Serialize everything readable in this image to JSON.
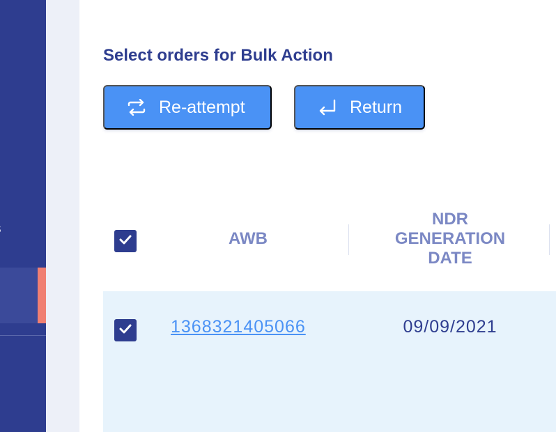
{
  "sidebar": {
    "partial_label": "s"
  },
  "bulk_action": {
    "title": "Select orders for Bulk Action",
    "reattempt_label": "Re-attempt",
    "return_label": "Return",
    "reattempt_icon": "repeat-icon",
    "return_icon": "return-arrow-icon"
  },
  "table": {
    "select_all_checked": true,
    "headers": {
      "awb": "AWB",
      "ndr_date": [
        "NDR",
        "GENERATION",
        "DATE"
      ]
    },
    "rows": [
      {
        "checked": true,
        "awb": "1368321405066",
        "ndr_date": "09/09/2021"
      }
    ]
  },
  "colors": {
    "sidebar_bg": "#2e3d8f",
    "accent_blue": "#4a92f5",
    "active_marker": "#f07f72",
    "row_highlight": "#e7f3fc",
    "header_text": "#7b88c4"
  }
}
